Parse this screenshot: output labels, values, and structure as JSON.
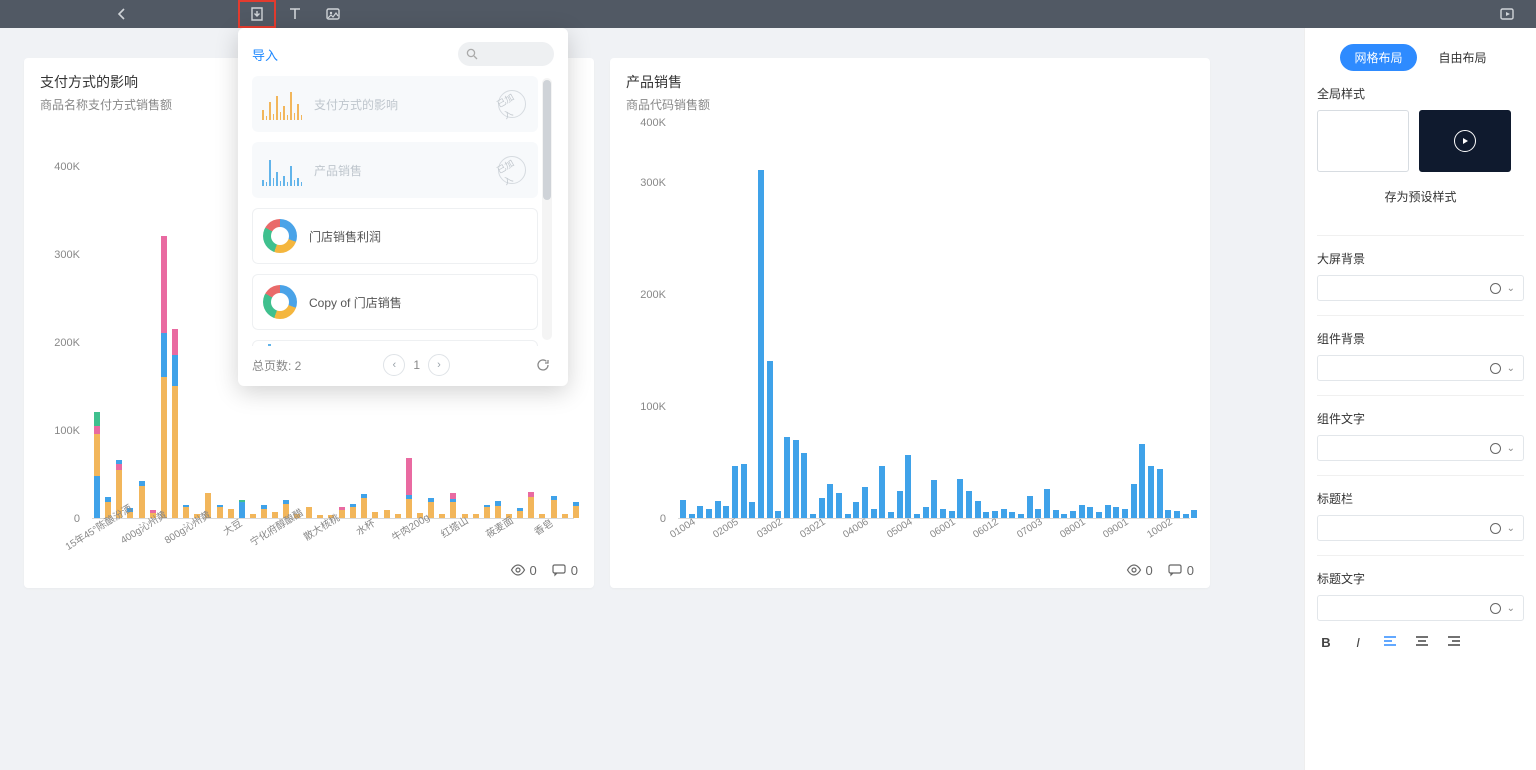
{
  "topbar": {
    "icons": [
      "import",
      "text",
      "image",
      "play"
    ]
  },
  "cards": {
    "left": {
      "title": "支付方式的影响",
      "subtitle": "商品名称支付方式销售额",
      "views": "0",
      "comments": "0"
    },
    "right": {
      "title": "产品销售",
      "subtitle": "商品代码销售额",
      "views": "0",
      "comments": "0"
    }
  },
  "importPanel": {
    "title": "导入",
    "items": [
      {
        "label": "支付方式的影响",
        "state": "added",
        "icon": "mini-bars-orange",
        "badge": "已加入"
      },
      {
        "label": "产品销售",
        "state": "added",
        "icon": "mini-bars-blue",
        "badge": "已加入"
      },
      {
        "label": "门店销售利润",
        "state": "normal",
        "icon": "donut"
      },
      {
        "label": "Copy of 门店销售",
        "state": "normal",
        "icon": "donut"
      }
    ],
    "pagesLabel": "总页数: 2",
    "page": "1"
  },
  "side": {
    "tabs": {
      "grid": "网格布局",
      "free": "自由布局"
    },
    "globalStyle": "全局样式",
    "savePreset": "存为预设样式",
    "fields": [
      {
        "label": "大屏背景"
      },
      {
        "label": "组件背景"
      },
      {
        "label": "组件文字"
      },
      {
        "label": "标题栏"
      },
      {
        "label": "标题文字"
      }
    ]
  },
  "chart_data": [
    {
      "type": "bar",
      "stacked": true,
      "title": "支付方式的影响",
      "xlabel": "",
      "ylabel": "",
      "ylim": [
        0,
        420000
      ],
      "yticks": [
        0,
        100000,
        200000,
        300000,
        400000
      ],
      "yticklabels": [
        "0",
        "100K",
        "200K",
        "300K",
        "400K"
      ],
      "categories_visible": [
        "15年45°陈酿汾酒",
        "400g沁州黄",
        "800g沁州黄",
        "大豆",
        "宁化府醇酿醋",
        "散大核桃",
        "水杯",
        "牛肉200g",
        "红塔山",
        "莜麦面",
        "香皂"
      ],
      "colors": {
        "blue": "#3fa2e9",
        "orange": "#f2b65b",
        "green": "#3fc08e",
        "pink": "#e96aa1"
      },
      "series_note": "stacked by 支付方式; values approximated from pixels",
      "bars": [
        {
          "x": 0,
          "segments": [
            {
              "c": "blue",
              "v": 48000
            },
            {
              "c": "orange",
              "v": 47000
            },
            {
              "c": "pink",
              "v": 10000
            },
            {
              "c": "green",
              "v": 15000
            }
          ]
        },
        {
          "x": 1,
          "segments": [
            {
              "c": "orange",
              "v": 18000
            },
            {
              "c": "blue",
              "v": 6000
            }
          ]
        },
        {
          "x": 2,
          "segments": [
            {
              "c": "orange",
              "v": 55000
            },
            {
              "c": "pink",
              "v": 6000
            },
            {
              "c": "blue",
              "v": 5000
            }
          ]
        },
        {
          "x": 3,
          "segments": [
            {
              "c": "orange",
              "v": 7000
            },
            {
              "c": "blue",
              "v": 4000
            }
          ]
        },
        {
          "x": 4,
          "segments": [
            {
              "c": "orange",
              "v": 36000
            },
            {
              "c": "blue",
              "v": 6000
            }
          ]
        },
        {
          "x": 5,
          "segments": [
            {
              "c": "orange",
              "v": 6000
            },
            {
              "c": "pink",
              "v": 3000
            }
          ]
        },
        {
          "x": 6,
          "segments": [
            {
              "c": "orange",
              "v": 160000
            },
            {
              "c": "blue",
              "v": 50000
            },
            {
              "c": "pink",
              "v": 110000
            }
          ]
        },
        {
          "x": 7,
          "segments": [
            {
              "c": "orange",
              "v": 150000
            },
            {
              "c": "blue",
              "v": 35000
            },
            {
              "c": "pink",
              "v": 30000
            }
          ]
        },
        {
          "x": 8,
          "segments": [
            {
              "c": "orange",
              "v": 12000
            },
            {
              "c": "blue",
              "v": 3000
            }
          ]
        },
        {
          "x": 9,
          "segments": [
            {
              "c": "orange",
              "v": 5000
            }
          ]
        },
        {
          "x": 10,
          "segments": [
            {
              "c": "orange",
              "v": 28000
            }
          ]
        },
        {
          "x": 11,
          "segments": [
            {
              "c": "orange",
              "v": 12000
            },
            {
              "c": "blue",
              "v": 3000
            }
          ]
        },
        {
          "x": 12,
          "segments": [
            {
              "c": "orange",
              "v": 10000
            }
          ]
        },
        {
          "x": 13,
          "segments": [
            {
              "c": "blue",
              "v": 18000
            },
            {
              "c": "green",
              "v": 3000
            }
          ]
        },
        {
          "x": 14,
          "segments": [
            {
              "c": "orange",
              "v": 4000
            }
          ]
        },
        {
          "x": 15,
          "segments": [
            {
              "c": "orange",
              "v": 10000
            },
            {
              "c": "blue",
              "v": 5000
            }
          ]
        },
        {
          "x": 16,
          "segments": [
            {
              "c": "orange",
              "v": 7000
            }
          ]
        },
        {
          "x": 17,
          "segments": [
            {
              "c": "orange",
              "v": 16000
            },
            {
              "c": "blue",
              "v": 5000
            }
          ]
        },
        {
          "x": 18,
          "segments": [
            {
              "c": "orange",
              "v": 4000
            }
          ]
        },
        {
          "x": 19,
          "segments": [
            {
              "c": "orange",
              "v": 12000
            }
          ]
        },
        {
          "x": 20,
          "segments": [
            {
              "c": "orange",
              "v": 3000
            }
          ]
        },
        {
          "x": 21,
          "segments": [
            {
              "c": "orange",
              "v": 3000
            }
          ]
        },
        {
          "x": 22,
          "segments": [
            {
              "c": "orange",
              "v": 9000
            },
            {
              "c": "pink",
              "v": 4000
            }
          ]
        },
        {
          "x": 23,
          "segments": [
            {
              "c": "orange",
              "v": 12000
            },
            {
              "c": "blue",
              "v": 4000
            }
          ]
        },
        {
          "x": 24,
          "segments": [
            {
              "c": "orange",
              "v": 23000
            },
            {
              "c": "blue",
              "v": 4000
            }
          ]
        },
        {
          "x": 25,
          "segments": [
            {
              "c": "orange",
              "v": 7000
            }
          ]
        },
        {
          "x": 26,
          "segments": [
            {
              "c": "orange",
              "v": 9000
            }
          ]
        },
        {
          "x": 27,
          "segments": [
            {
              "c": "orange",
              "v": 5000
            }
          ]
        },
        {
          "x": 28,
          "segments": [
            {
              "c": "orange",
              "v": 22000
            },
            {
              "c": "blue",
              "v": 4000
            },
            {
              "c": "pink",
              "v": 42000
            }
          ]
        },
        {
          "x": 29,
          "segments": [
            {
              "c": "orange",
              "v": 6000
            }
          ]
        },
        {
          "x": 30,
          "segments": [
            {
              "c": "orange",
              "v": 18000
            },
            {
              "c": "blue",
              "v": 5000
            }
          ]
        },
        {
          "x": 31,
          "segments": [
            {
              "c": "orange",
              "v": 4000
            }
          ]
        },
        {
          "x": 32,
          "segments": [
            {
              "c": "orange",
              "v": 18000
            },
            {
              "c": "blue",
              "v": 4000
            },
            {
              "c": "pink",
              "v": 6000
            }
          ]
        },
        {
          "x": 33,
          "segments": [
            {
              "c": "orange",
              "v": 5000
            }
          ]
        },
        {
          "x": 34,
          "segments": [
            {
              "c": "orange",
              "v": 5000
            }
          ]
        },
        {
          "x": 35,
          "segments": [
            {
              "c": "orange",
              "v": 12000
            },
            {
              "c": "blue",
              "v": 3000
            }
          ]
        },
        {
          "x": 36,
          "segments": [
            {
              "c": "orange",
              "v": 14000
            },
            {
              "c": "blue",
              "v": 5000
            }
          ]
        },
        {
          "x": 37,
          "segments": [
            {
              "c": "orange",
              "v": 4000
            }
          ]
        },
        {
          "x": 38,
          "segments": [
            {
              "c": "orange",
              "v": 8000
            },
            {
              "c": "blue",
              "v": 3000
            }
          ]
        },
        {
          "x": 39,
          "segments": [
            {
              "c": "orange",
              "v": 24000
            },
            {
              "c": "pink",
              "v": 5000
            }
          ]
        },
        {
          "x": 40,
          "segments": [
            {
              "c": "orange",
              "v": 5000
            }
          ]
        },
        {
          "x": 41,
          "segments": [
            {
              "c": "orange",
              "v": 20000
            },
            {
              "c": "blue",
              "v": 5000
            }
          ]
        },
        {
          "x": 42,
          "segments": [
            {
              "c": "orange",
              "v": 5000
            }
          ]
        },
        {
          "x": 43,
          "segments": [
            {
              "c": "orange",
              "v": 14000
            },
            {
              "c": "blue",
              "v": 4000
            }
          ]
        }
      ]
    },
    {
      "type": "bar",
      "title": "产品销售",
      "xlabel": "",
      "ylabel": "",
      "ylim": [
        0,
        330000
      ],
      "yticks": [
        0,
        100000,
        200000,
        300000
      ],
      "yticklabels": [
        "0",
        "100K",
        "200K",
        "300K",
        "400K"
      ],
      "color": "#3fa2e9",
      "categories_visible": [
        "01004",
        "02005",
        "03002",
        "03021",
        "04006",
        "05004",
        "06001",
        "06012",
        "07003",
        "08001",
        "09001",
        "10002"
      ],
      "values": [
        16000,
        4000,
        11000,
        8000,
        15000,
        11000,
        46000,
        48000,
        14000,
        310000,
        140000,
        6000,
        72000,
        70000,
        58000,
        4000,
        18000,
        30000,
        22000,
        4000,
        14000,
        28000,
        8000,
        46000,
        5000,
        24000,
        56000,
        4000,
        10000,
        34000,
        8000,
        6000,
        35000,
        24000,
        15000,
        5000,
        6000,
        8000,
        5000,
        4000,
        20000,
        8000,
        26000,
        7000,
        4000,
        6000,
        12000,
        10000,
        5000,
        12000,
        10000,
        8000,
        30000,
        66000,
        46000,
        44000,
        7000,
        6000,
        4000,
        7000
      ]
    }
  ]
}
